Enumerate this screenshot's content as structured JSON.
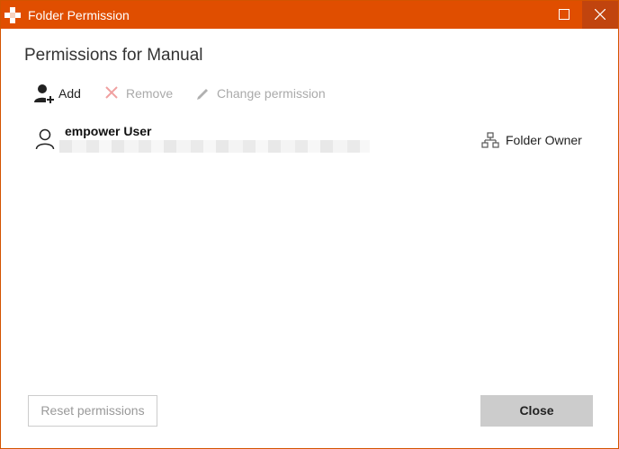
{
  "window": {
    "title": "Folder Permission",
    "accent_color": "#e04e00"
  },
  "heading": "Permissions for Manual",
  "toolbar": {
    "add_label": "Add",
    "remove_label": "Remove",
    "change_label": "Change permission"
  },
  "permissions": [
    {
      "name": "empower User",
      "icon": "user-icon",
      "role": "Folder Owner",
      "role_icon": "org-hierarchy-icon"
    }
  ],
  "footer": {
    "reset_label": "Reset permissions",
    "close_label": "Close"
  }
}
